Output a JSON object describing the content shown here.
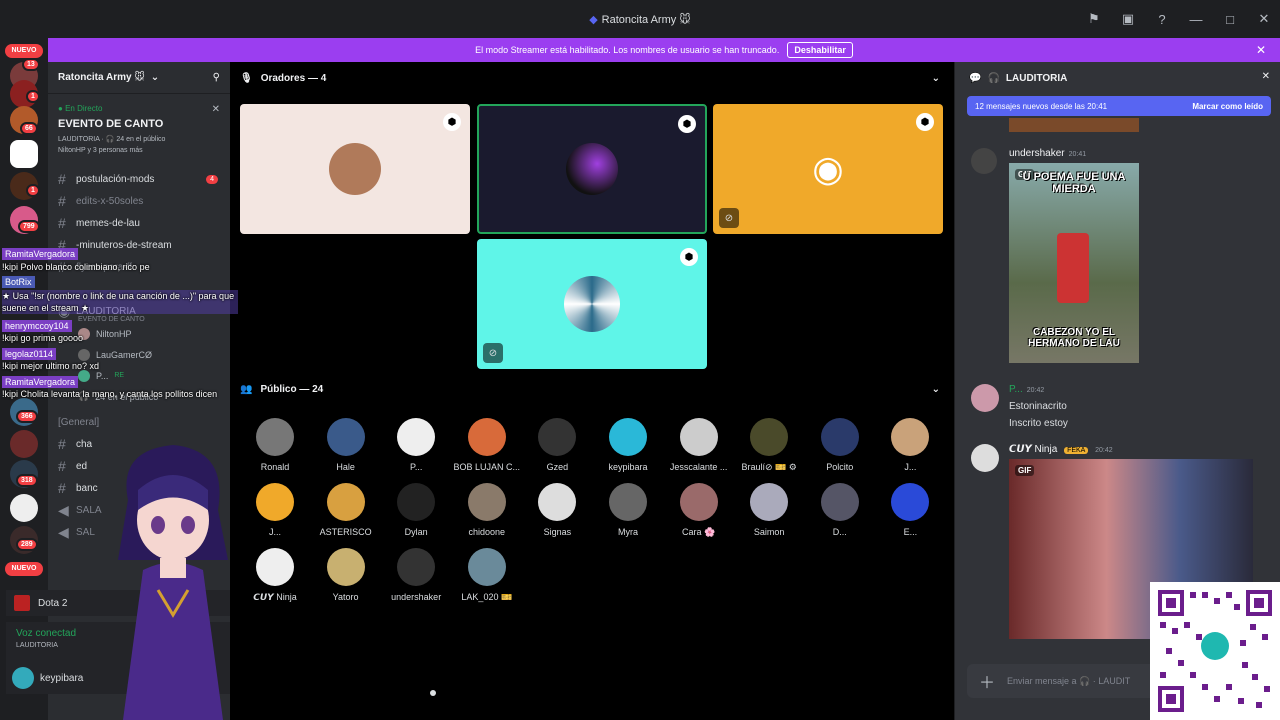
{
  "window": {
    "title": "Ratoncita Army 🐭"
  },
  "banner": {
    "text": "El modo Streamer está habilitado. Los nombres de usuario se han truncado.",
    "button": "Deshabilitar"
  },
  "rail": {
    "nuevo_top": "NUEVO",
    "nuevo_bottom": "NUEVO",
    "badges": [
      "13",
      "1",
      "66",
      "1",
      "799",
      "366",
      "318",
      "289",
      "1"
    ]
  },
  "server": {
    "name": "Ratoncita Army 🐭",
    "event": {
      "status": "En Directo",
      "title": "EVENTO DE CANTO",
      "meta1": "LAUDITORIA · 🎧 24 en el público",
      "meta2": "NiltonHP y 3 personas más"
    },
    "channels": [
      {
        "name": "postulación-mods",
        "count": "4"
      },
      {
        "name": "edits-x-50soles"
      },
      {
        "name": "memes-de-lau"
      },
      {
        "name": "-minuteros-de-stream"
      },
      {
        "name": "flyers-para-ff"
      }
    ],
    "stage_channel": "LAUDITORIA",
    "stage_sub": "EVENTO DE CANTO",
    "voice_users": [
      "NiltonHP",
      "LauGamerCØ",
      "P...",
      "24 en el público"
    ],
    "voice_user_tag": "RE",
    "category": "[General]",
    "channels2": [
      "cha",
      "ed",
      "banc",
      "SALA",
      "SAL"
    ]
  },
  "bottom": {
    "activity": "Dota 2",
    "voice_status": "Voz conectad",
    "voice_channel": "LAUDITORIA",
    "user": "keypibara"
  },
  "stage": {
    "speakers_header": "Oradores — 4",
    "audience_header": "Público — 24",
    "speakers": [
      {
        "bg": "#f3e6e1"
      },
      {
        "bg": "#1a1a2e"
      },
      {
        "bg": "#f0a92a"
      },
      {
        "bg": "#5ff5e8"
      }
    ],
    "audience": [
      "Ronald",
      "Hale",
      "P...",
      "BOB LUJAN C...",
      "Gzed",
      "keypibara",
      "Jesscalante ...",
      "Braulí⊘ 🎫 ⚙",
      "Polcito",
      "J...",
      "J...",
      "ASTERISCO",
      "Dylan",
      "chidoone",
      "Signas",
      "Myra",
      "Cara 🌸",
      "Saimon",
      "D...",
      "E...",
      "𝘾𝙐𝙔 Ninja",
      "Yatoro",
      "undershaker",
      "LAK_020 🎫"
    ]
  },
  "chat": {
    "channel": "LAUDITORIA",
    "new_messages": "12 mensajes nuevos desde las 20:41",
    "mark_read": "Marcar como leído",
    "messages": [
      {
        "user": "undershaker",
        "time": "20:41",
        "gif_top": "U POEMA FUE UNA MIERDA",
        "gif_bottom": "CABEZON YO EL HERMANO DE LAU"
      },
      {
        "user": "P...",
        "time": "20:42",
        "lines": [
          "Estoninacrito",
          "Inscrito estoy"
        ]
      },
      {
        "user": "𝘾𝙐𝙔 Ninja",
        "tag": "FEKA",
        "time": "20:42"
      }
    ],
    "gif_label": "GIF",
    "input_placeholder": "Enviar mensaje a 🎧 · LAUDIT"
  },
  "overlay": {
    "lines": [
      {
        "name": "RamitaVergadora",
        "text": "!kipi Polvo blanco colimbiano, rico pe"
      },
      {
        "name": "BotRix",
        "text": "★ Usa \"!sr (nombre o link de una canción de ...)\" para que suene en el stream ★"
      },
      {
        "name": "henrymccoy104",
        "text": "!kipi go prima goooo"
      },
      {
        "name": "legolaz0114",
        "text": "!kipi mejor ultimo no? xd"
      },
      {
        "name": "RamitaVergadora",
        "text": "!kipi Cholita levanta la mano, y canta los pollitos dicen"
      }
    ]
  },
  "qr": {
    "brand": "yape"
  },
  "colors": {
    "banner": "#9b3ef0",
    "live": "#23a55a",
    "accent": "#5865f2"
  }
}
